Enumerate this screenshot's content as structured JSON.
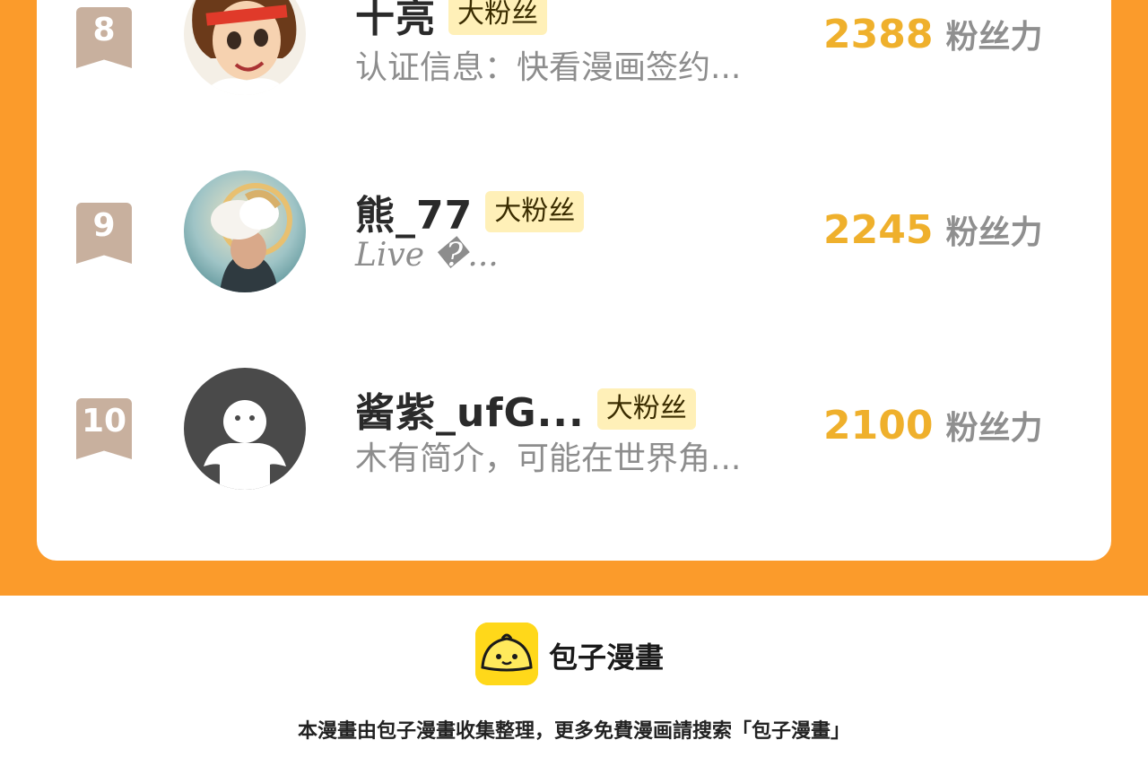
{
  "leaderboard": {
    "rows": [
      {
        "rank": "8",
        "name": "十亮",
        "tag": "大粉丝",
        "description": "认证信息：快看漫画签约...",
        "fans_value": "2388",
        "fans_unit": "粉丝力",
        "avatar": "cartoon-girl-headband-avatar"
      },
      {
        "rank": "9",
        "name": "熊_77",
        "tag": "大粉丝",
        "description": "Live �...",
        "fans_value": "2245",
        "fans_unit": "粉丝力",
        "avatar": "painted-person-cloud-head-avatar"
      },
      {
        "rank": "10",
        "name": "酱紫_ufG...",
        "tag": "大粉丝",
        "description": "木有简介，可能在世界角...",
        "fans_value": "2100",
        "fans_unit": "粉丝力",
        "avatar": "default-user-silhouette-avatar"
      }
    ]
  },
  "footer": {
    "brand": "包子漫畫",
    "note": "本漫畫由包子漫畫收集整理，更多免費漫画請搜索「包子漫畫」",
    "logo_icon": "bun-face-logo-icon"
  },
  "colors": {
    "orange_band": "#FB9B2B",
    "badge": "#C8B09E",
    "fans_number": "#EFB02C",
    "tag_bg": "#FFF0B8",
    "logo_yellow": "#FFD81A"
  }
}
